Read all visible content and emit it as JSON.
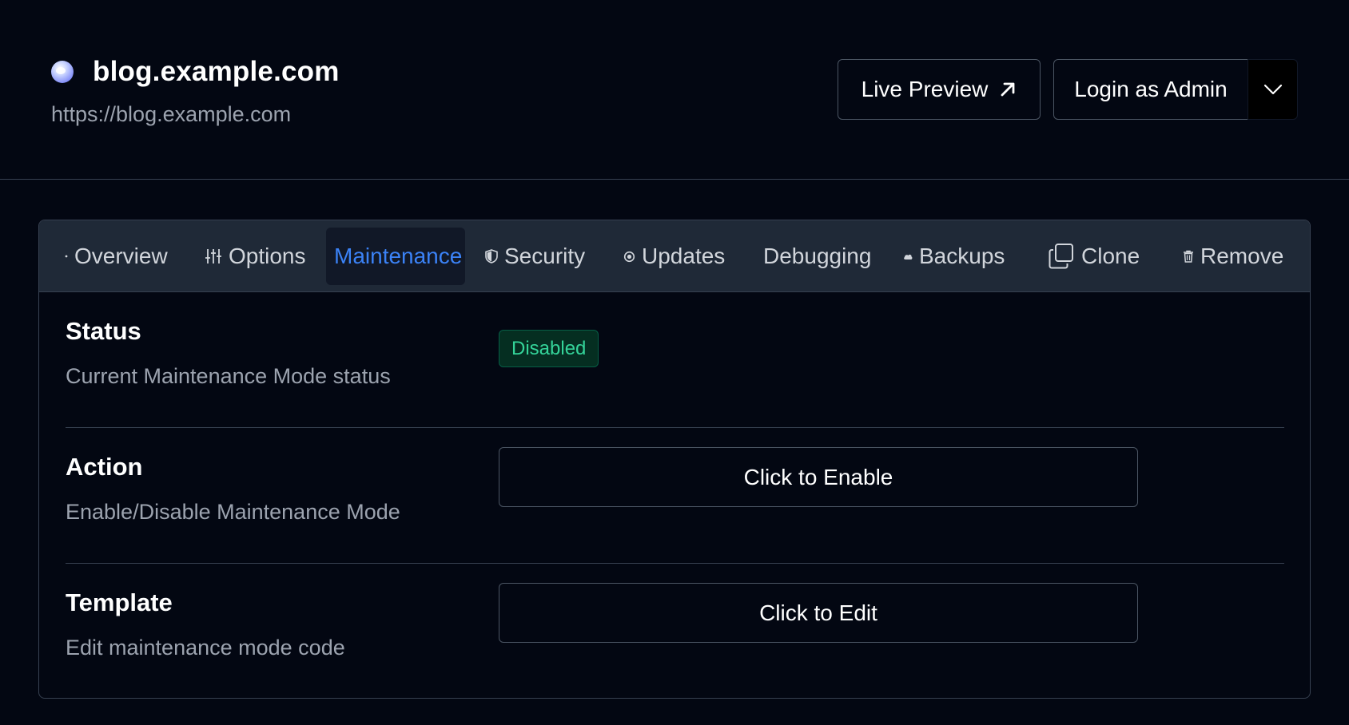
{
  "site": {
    "title": "blog.example.com",
    "url": "https://blog.example.com",
    "icon": "globe-icon"
  },
  "header_actions": {
    "live_preview": "Live Preview",
    "login_admin": "Login as Admin"
  },
  "tabs": [
    {
      "label": "Overview",
      "icon": "dot-icon"
    },
    {
      "label": "Options",
      "icon": "sliders-icon"
    },
    {
      "label": "Maintenance",
      "icon": "",
      "active": true
    },
    {
      "label": "Security",
      "icon": "shield-icon"
    },
    {
      "label": "Updates",
      "icon": "refresh-icon"
    },
    {
      "label": "Debugging",
      "icon": ""
    },
    {
      "label": "Backups",
      "icon": "cloud-icon"
    },
    {
      "label": "Clone",
      "icon": "copy-icon"
    },
    {
      "label": "Remove",
      "icon": "trash-icon"
    }
  ],
  "maintenance": {
    "status": {
      "label": "Status",
      "description": "Current Maintenance Mode status",
      "badge": "Disabled"
    },
    "action": {
      "label": "Action",
      "description": "Enable/Disable Maintenance Mode",
      "button": "Click to Enable"
    },
    "template": {
      "label": "Template",
      "description": "Edit maintenance mode code",
      "button": "Click to Edit"
    }
  },
  "colors": {
    "background": "#030712",
    "active_tab": "#3b82f6",
    "badge_text": "#34d399",
    "tabbar": "#1f2937"
  }
}
